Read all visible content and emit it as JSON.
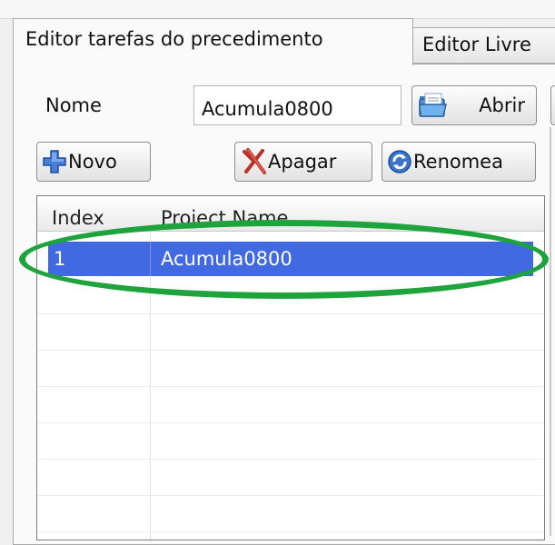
{
  "tabs": [
    {
      "label": "Editor tarefas do precedimento",
      "active": true
    },
    {
      "label": "Editor Livre",
      "active": false
    }
  ],
  "form": {
    "name_label": "Nome",
    "name_value": "Acumula0800",
    "open_button": "Abrir"
  },
  "toolbar": {
    "new_button": "Novo",
    "delete_button": "Apagar",
    "rename_button": "Renomea"
  },
  "table": {
    "columns": [
      "Index",
      "Project Name"
    ],
    "rows": [
      {
        "index": "1",
        "name": "Acumula0800",
        "selected": true
      }
    ]
  },
  "colors": {
    "selection": "#4169e1",
    "annotation": "#1fa33c"
  },
  "icons": [
    "folder-open-icon",
    "plus-icon",
    "delete-x-icon",
    "refresh-icon"
  ]
}
